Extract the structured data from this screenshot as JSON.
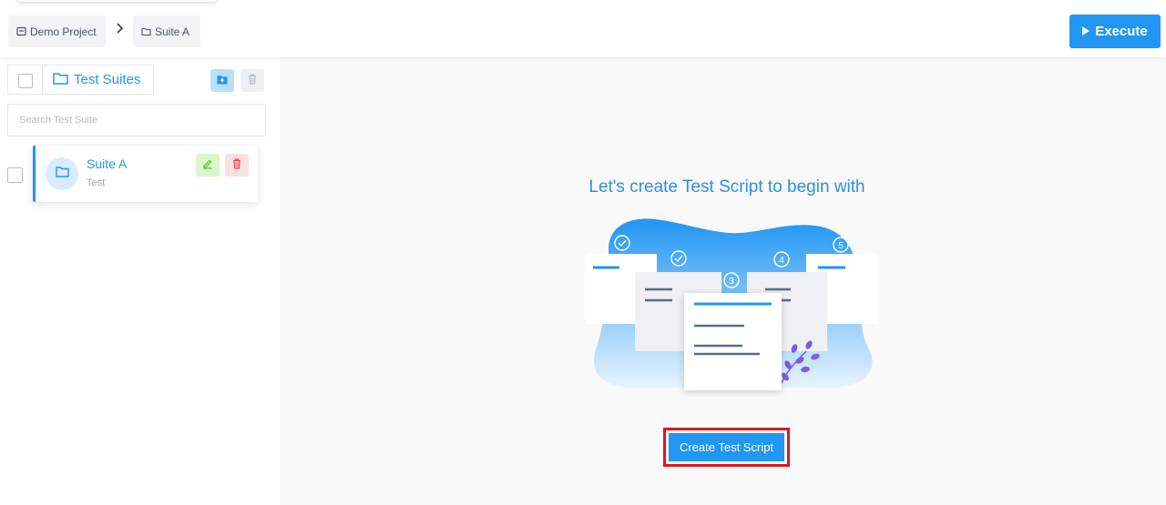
{
  "breadcrumb": {
    "project_label": "Demo Project",
    "suite_label": "Suite A"
  },
  "toolbar": {
    "execute_label": "Execute"
  },
  "sidebar": {
    "header_label": "Test Suites",
    "search_placeholder": "Search Test Suite",
    "suites": [
      {
        "name": "Suite A",
        "description": "Test"
      }
    ]
  },
  "main": {
    "empty_title": "Let's create Test Script to begin with",
    "create_button_label": "Create Test Script",
    "illustration_steps": [
      "3",
      "4",
      "5"
    ]
  },
  "colors": {
    "accent": "#2196f3",
    "highlight_border": "#e3151d",
    "edit_bg": "#dcf5cf",
    "delete_bg": "#fde0e0"
  },
  "icons": [
    "project-icon",
    "chevron-right-icon",
    "folder-icon",
    "play-icon",
    "add-folder-icon",
    "trash-icon",
    "edit-icon",
    "check-icon",
    "leaf-icon"
  ]
}
